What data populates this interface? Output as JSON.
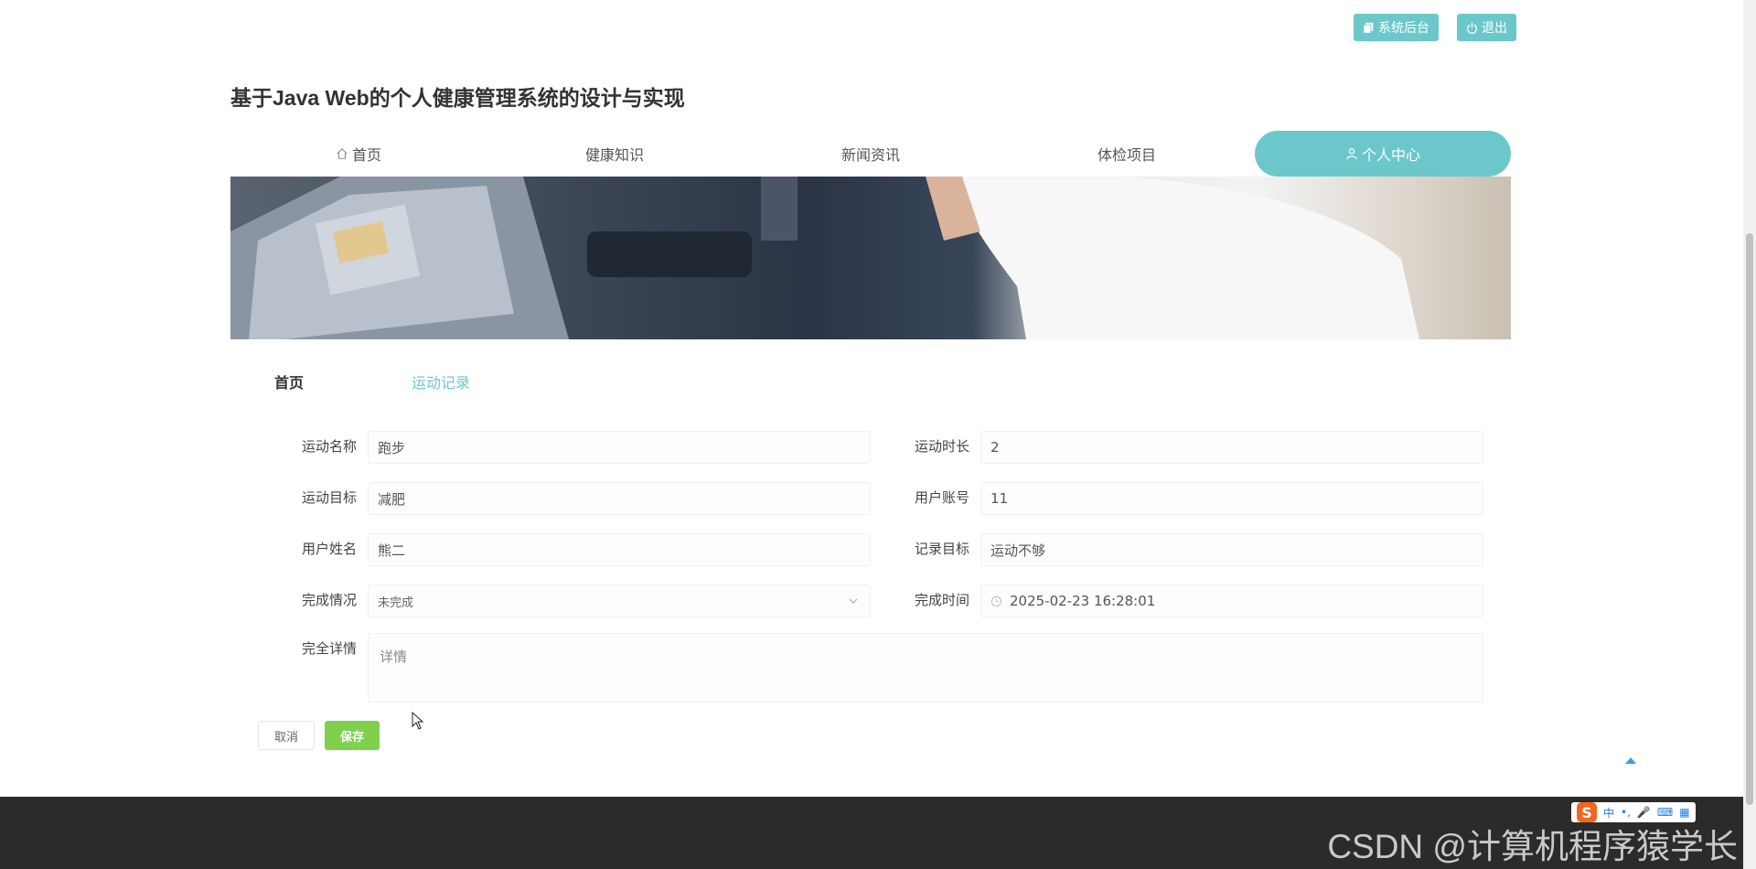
{
  "header": {
    "admin_label": "系统后台",
    "logout_label": "退出",
    "site_title": "基于Java Web的个人健康管理系统的设计与实现"
  },
  "nav": {
    "items": [
      {
        "label": "首页",
        "icon": "home-icon"
      },
      {
        "label": "健康知识"
      },
      {
        "label": "新闻资讯"
      },
      {
        "label": "体检项目"
      },
      {
        "label": "个人中心",
        "icon": "user-icon",
        "active": true
      }
    ]
  },
  "breadcrumb": {
    "home": "首页",
    "current": "运动记录"
  },
  "form": {
    "exercise_name": {
      "label": "运动名称",
      "value": "跑步"
    },
    "duration": {
      "label": "运动时长",
      "value": "2"
    },
    "goal": {
      "label": "运动目标",
      "value": "减肥"
    },
    "account": {
      "label": "用户账号",
      "value": "11"
    },
    "user_name": {
      "label": "用户姓名",
      "value": "熊二"
    },
    "record_goal": {
      "label": "记录目标",
      "value": "运动不够"
    },
    "status": {
      "label": "完成情况",
      "value": "未完成"
    },
    "finish_time": {
      "label": "完成时间",
      "value": "2025-02-23 16:28:01"
    },
    "details": {
      "label": "完全详情",
      "placeholder": "详情"
    }
  },
  "buttons": {
    "cancel": "取消",
    "save": "保存"
  },
  "colors": {
    "accent": "#6cc7cb",
    "save": "#7ed04d",
    "footer": "#2b2b2b"
  },
  "footer": {
    "watermark": "CSDN @计算机程序猿学长",
    "ime_label": "中"
  }
}
